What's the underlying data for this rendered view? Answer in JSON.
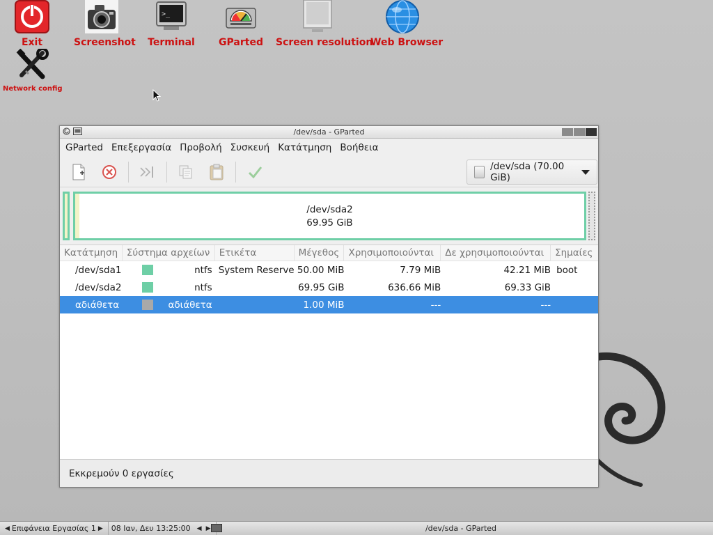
{
  "desktop": {
    "icons": [
      {
        "label": "Exit",
        "icon": "power-icon"
      },
      {
        "label": "Screenshot",
        "icon": "camera-icon"
      },
      {
        "label": "Terminal",
        "icon": "terminal-icon"
      },
      {
        "label": "GParted",
        "icon": "disk-gauge-icon"
      },
      {
        "label": "Screen resolution",
        "icon": "monitor-icon"
      },
      {
        "label": "Web Browser",
        "icon": "globe-icon"
      },
      {
        "label": "Network config",
        "icon": "tools-icon"
      }
    ]
  },
  "window": {
    "title": "/dev/sda - GParted",
    "menu": [
      "GParted",
      "Επεξεργασία",
      "Προβολή",
      "Συσκευή",
      "Κατάτμηση",
      "Βοήθεια"
    ],
    "toolbar": {
      "device": "/dev/sda (70.00 GiB)",
      "tools": [
        "new-partition-icon",
        "delete-icon",
        "resize-move-icon",
        "copy-icon",
        "paste-icon",
        "apply-icon"
      ]
    },
    "map": {
      "name": "/dev/sda2",
      "size": "69.95 GiB"
    },
    "table": {
      "headers": [
        "Κατάτμηση",
        "Σύστημα αρχείων",
        "Ετικέτα",
        "Μέγεθος",
        "Χρησιμοποιούνται",
        "Δε χρησιμοποιούνται",
        "Σημαίες"
      ],
      "rows": [
        {
          "partition": "/dev/sda1",
          "filesystem": "ntfs",
          "label": "System Reserved",
          "size": "50.00 MiB",
          "used": "7.79 MiB",
          "unused": "42.21 MiB",
          "flags": "boot",
          "color": "#6ecfa6",
          "selected": false
        },
        {
          "partition": "/dev/sda2",
          "filesystem": "ntfs",
          "label": "",
          "size": "69.95 GiB",
          "used": "636.66 MiB",
          "unused": "69.33 GiB",
          "flags": "",
          "color": "#6ecfa6",
          "selected": false
        },
        {
          "partition": "αδιάθετα",
          "filesystem": "αδιάθετα",
          "label": "",
          "size": "1.00 MiB",
          "used": "---",
          "unused": "---",
          "flags": "",
          "color": "#a9a9a9",
          "selected": true
        }
      ]
    },
    "status": "Εκκρεμούν 0 εργασίες"
  },
  "taskbar": {
    "workspace": "Επιφάνεια Εργασίας 1",
    "datetime": "08 Ιαν, Δευ 13:25:00",
    "task": "/dev/sda - GParted"
  }
}
